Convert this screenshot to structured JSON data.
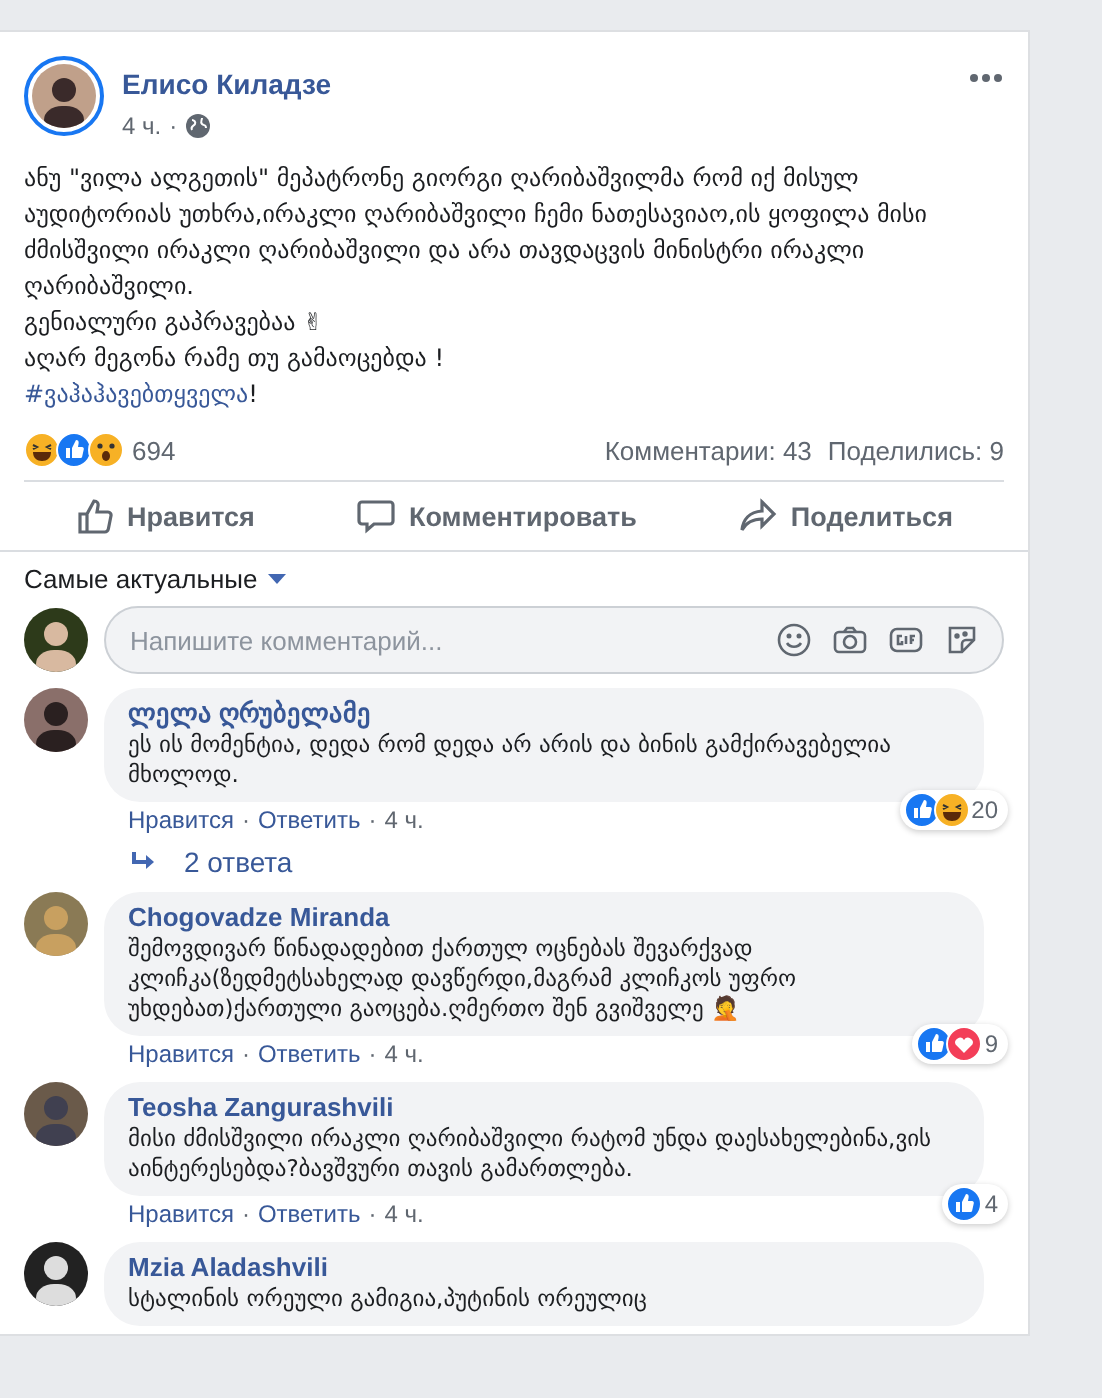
{
  "post": {
    "author": "Елисо Киладзе",
    "time": "4 ч.",
    "separator": "·",
    "paragraphs": [
      "ანუ \"ვილა ალგეთის\" მეპატრონე გიორგი ღარიბაშვილმა რომ იქ მისულ აუდიტორიას უთხრა,ირაკლი ღარიბაშვილი ჩემი ნათესავიაო,ის ყოფილა მისი ძმისშვილი ირაკლი ღარიბაშვილი და არა თავდაცვის მინისტრი ირაკლი ღარიბაშვილი.",
      "გენიალური გაპრავებაა ✌",
      "აღარ მეგონა რამე თუ გამაოცებდა !"
    ],
    "hashtag": {
      "tag": "#ვაჰაჰავებთყველა",
      "after": "!"
    },
    "reactions": [
      {
        "kind": "haha"
      },
      {
        "kind": "like"
      },
      {
        "kind": "wow"
      }
    ],
    "reaction_count": "694",
    "comments_count": "Комментарии: 43",
    "shares_count": "Поделились: 9",
    "actions": [
      {
        "kind": "like",
        "label": "Нравится"
      },
      {
        "kind": "comment",
        "label": "Комментировать"
      },
      {
        "kind": "share",
        "label": "Поделиться"
      }
    ]
  },
  "sort": {
    "label": "Самые актуальные"
  },
  "composer": {
    "placeholder": "Напишите комментарий..."
  },
  "comments": [
    {
      "author": "ლელა ღრუბელამე",
      "text": "ეს ის მომენტია, დედა რომ დედა არ არის და ბინის გამქირავებელია მხოლოდ.",
      "reactions": [
        {
          "kind": "like"
        },
        {
          "kind": "haha"
        }
      ],
      "reaction_count": "20",
      "actions": [
        "Нравится",
        "Ответить"
      ],
      "time": "4 ч.",
      "replies": "2 ответа"
    },
    {
      "author": "Chogovadze Miranda",
      "text": "შემოვდივარ წინადადებით ქართულ ოცნებას შევარქვად კლიჩკა(ზედმეტსახელად დავწერდი,მაგრამ კლიჩკოს უფრო უხდებათ)ქართული გაოცება.ღმერთო შენ გვიშველე 🤦",
      "reactions": [
        {
          "kind": "like"
        },
        {
          "kind": "love"
        }
      ],
      "reaction_count": "9",
      "actions": [
        "Нравится",
        "Ответить"
      ],
      "time": "4 ч."
    },
    {
      "author": "Teosha Zangurashvili",
      "text": "მისი ძმისშვილი ირაკლი ღარიბაშვილი რატომ უნდა დაესახელებინა,ვის აინტერესებდა?ბავშვური თავის გამართლება.",
      "reactions": [
        {
          "kind": "like"
        }
      ],
      "reaction_count": "4",
      "actions": [
        "Нравится",
        "Ответить"
      ],
      "time": "4 ч."
    },
    {
      "author": "Mzia Aladashvili",
      "text": "სტალინის ორეული გამიგია,პუტინის ორეულიც"
    }
  ]
}
